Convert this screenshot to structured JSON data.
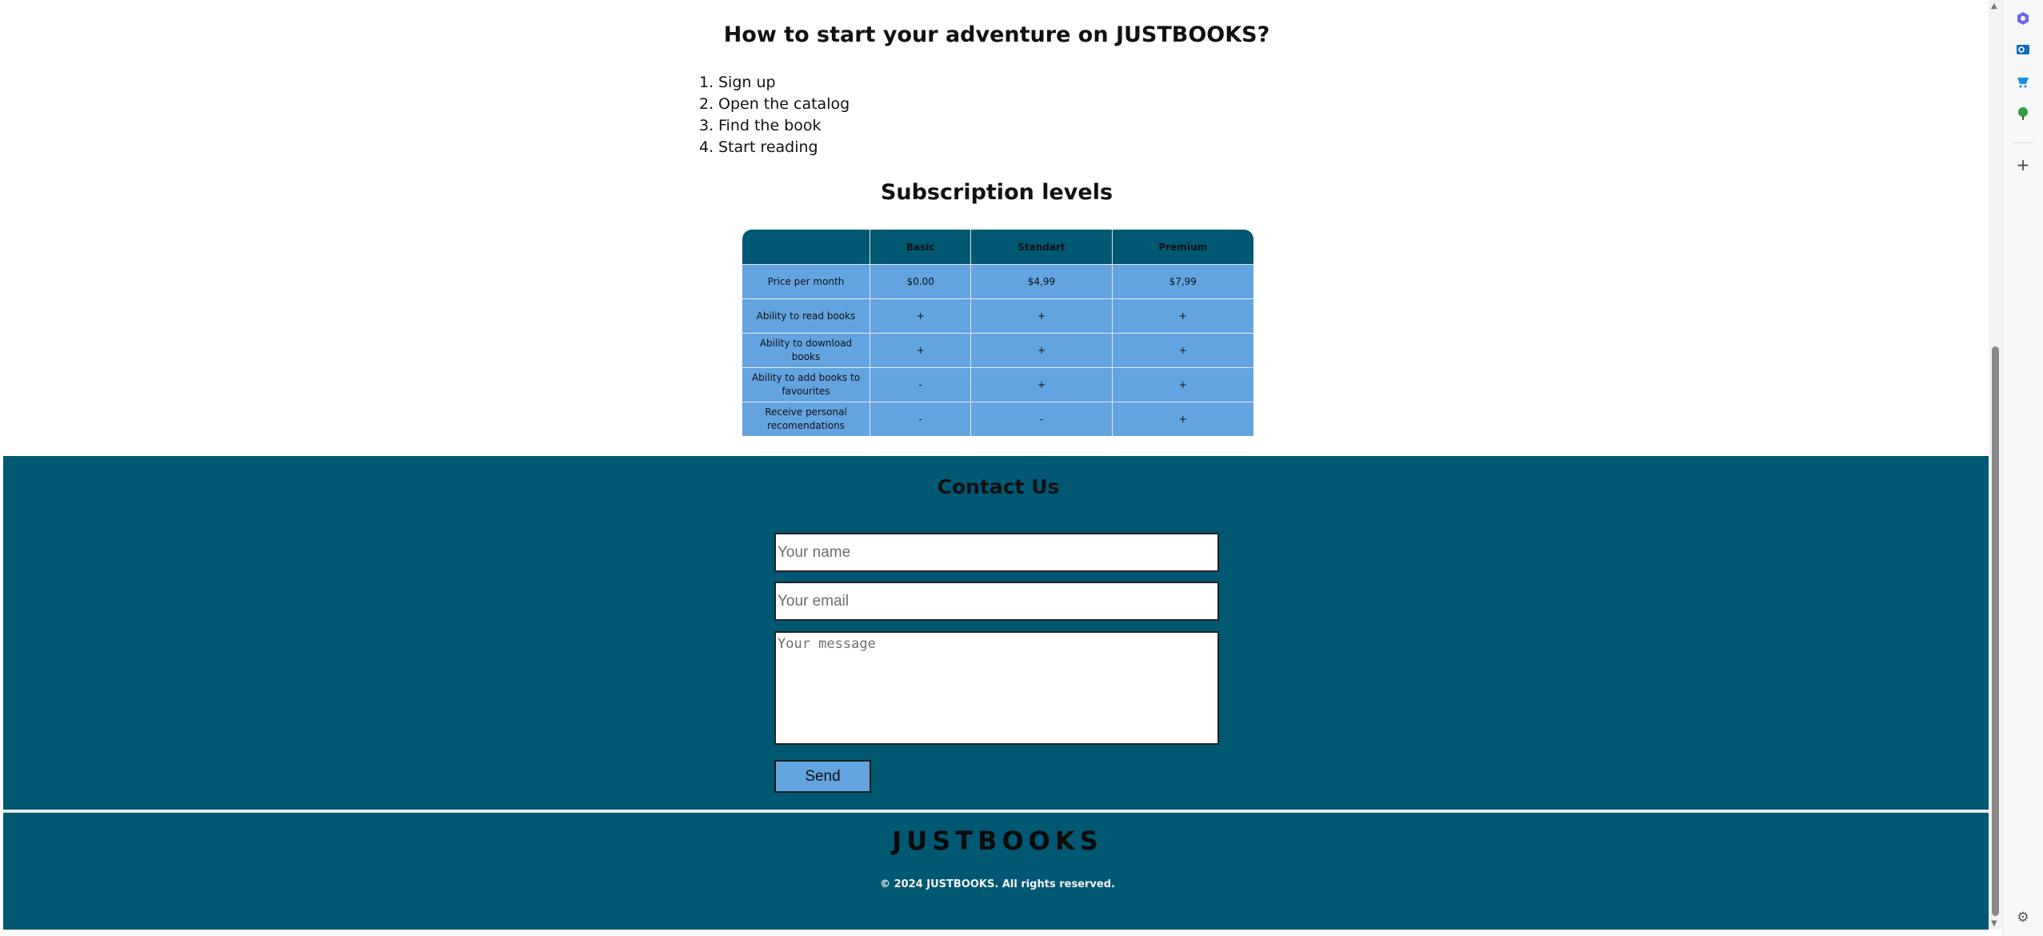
{
  "how_to": {
    "title": "How to start your adventure on JUSTBOOKS?",
    "steps": [
      {
        "num": "1.",
        "text": "Sign up"
      },
      {
        "num": "2.",
        "text": "Open the catalog"
      },
      {
        "num": "3.",
        "text": "Find the book"
      },
      {
        "num": "4.",
        "text": "Start reading"
      }
    ]
  },
  "subscription": {
    "title": "Subscription levels",
    "headers": [
      "",
      "Basic",
      "Standart",
      "Premium"
    ],
    "rows": [
      {
        "label": "Price per month",
        "values": [
          "$0.00",
          "$4,99",
          "$7,99"
        ]
      },
      {
        "label": "Ability to read books",
        "values": [
          "+",
          "+",
          "+"
        ]
      },
      {
        "label": "Ability to download books",
        "values": [
          "+",
          "+",
          "+"
        ]
      },
      {
        "label": "Ability to add books to favourites",
        "values": [
          "-",
          "+",
          "+"
        ]
      },
      {
        "label": "Receive personal recomendations",
        "values": [
          "-",
          "-",
          "+"
        ]
      }
    ]
  },
  "contact": {
    "title": "Contact Us",
    "name_placeholder": "Your name",
    "email_placeholder": "Your email",
    "message_placeholder": "Your message",
    "send_label": "Send"
  },
  "footer": {
    "logo": "JUSTBOOKS",
    "copyright": "© 2024 JUSTBOOKS. All rights reserved."
  },
  "browser_sidebar": {
    "icons": [
      "copilot-icon",
      "outlook-icon",
      "shopping-icon",
      "games-icon",
      "add-icon",
      "settings-icon"
    ],
    "colors": {
      "accent": "#005873",
      "table_cell": "#63a4e0"
    }
  }
}
